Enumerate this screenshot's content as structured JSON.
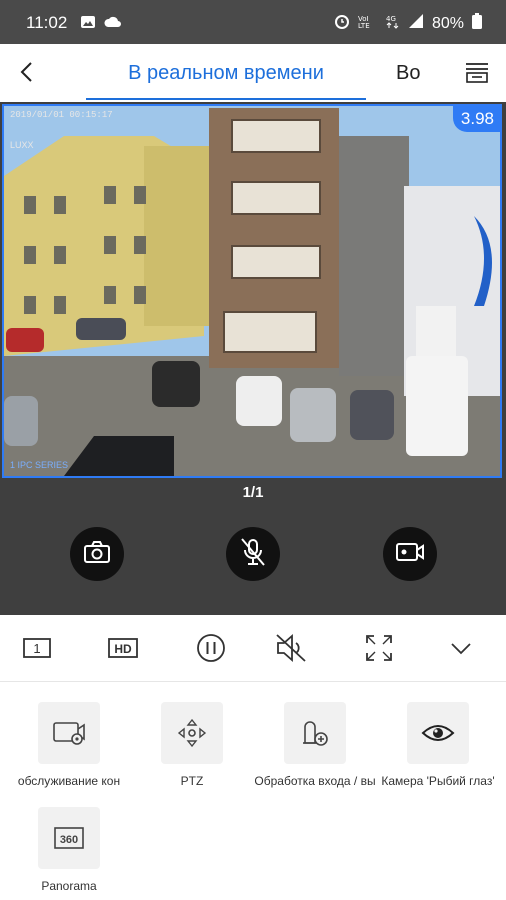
{
  "status_bar": {
    "time": "11:02",
    "battery": "80%",
    "icons": [
      "gallery-icon",
      "cloud-icon",
      "alarm-icon",
      "volte-icon",
      "data-icon",
      "signal-icon",
      "battery-icon"
    ]
  },
  "header": {
    "back_icon": "back-arrow-icon",
    "tab_live": "В реальном времени",
    "tab_playback": "Во",
    "menu_icon": "device-list-icon"
  },
  "video": {
    "osd_timestamp": "2019/01/01 00:15:17",
    "osd_channel": "LUXX",
    "osd_bottom": "1 IPC SERIES",
    "rate": "3.98",
    "page_indicator": "1/1"
  },
  "controls": {
    "snapshot_icon": "camera-icon",
    "talk_icon": "microphone-muted-icon",
    "record_icon": "video-record-icon"
  },
  "toolbar": {
    "split_label": "1",
    "quality_label": "HD",
    "icons": [
      "split-screen-icon",
      "hd-quality-icon",
      "pause-icon",
      "sound-muted-icon",
      "fullscreen-icon",
      "chevron-down-icon"
    ]
  },
  "features": [
    {
      "label": "обслуживание кон",
      "icon": "maintenance-icon"
    },
    {
      "label": "PTZ",
      "icon": "ptz-icon"
    },
    {
      "label": "Обработка входа / вы",
      "icon": "io-handling-icon"
    },
    {
      "label": "Камера 'Рыбий глаз'",
      "icon": "fisheye-icon"
    },
    {
      "label": "Panorama",
      "icon": "panorama-360-icon"
    }
  ],
  "colors": {
    "accent": "#1d6fdb",
    "status_bar": "#4a4a4a",
    "video_bg": "#3f3f3f",
    "selection_border": "#2f7bf5"
  }
}
